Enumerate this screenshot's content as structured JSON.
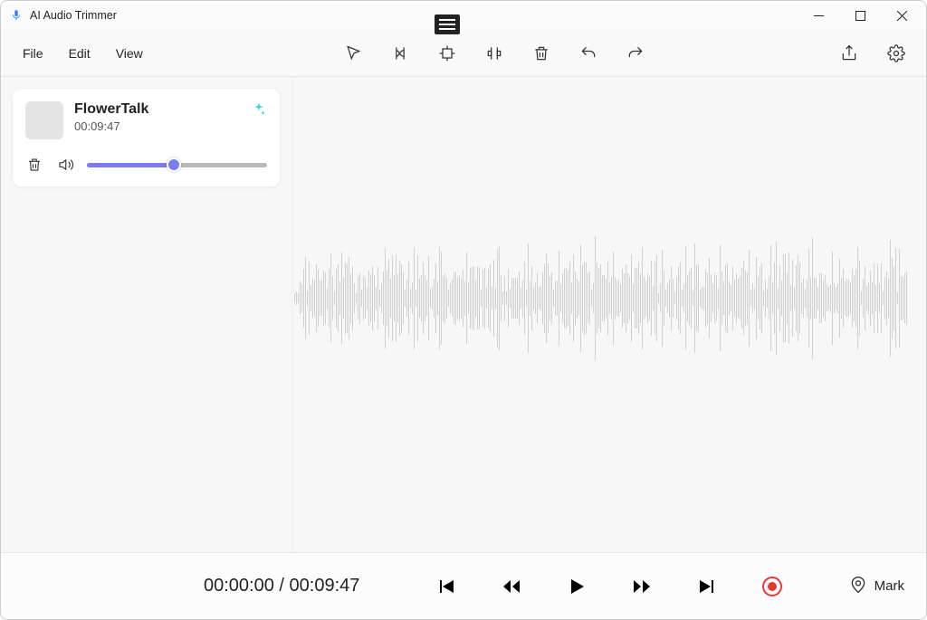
{
  "window": {
    "title": "AI Audio Trimmer"
  },
  "menu": {
    "file": "File",
    "edit": "Edit",
    "view": "View"
  },
  "toolbar_icons": {
    "pointer": "pointer-icon",
    "split": "split-icon",
    "crop": "crop-icon",
    "silence": "silence-icon",
    "delete": "delete-icon",
    "undo": "undo-icon",
    "redo": "redo-icon",
    "share": "share-icon",
    "settings": "settings-icon"
  },
  "clip": {
    "title": "FlowerTalk",
    "duration": "00:09:47",
    "volume_percent": 48
  },
  "playback": {
    "current": "00:00:00",
    "total": "00:09:47",
    "separator": " / "
  },
  "mark_label": "Mark"
}
